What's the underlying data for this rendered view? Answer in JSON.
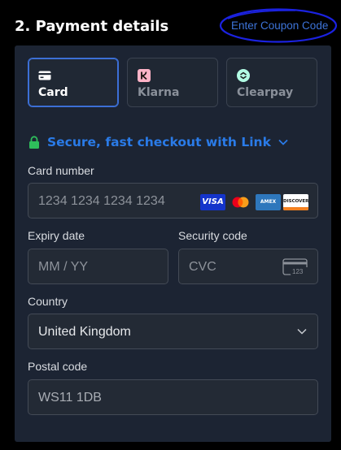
{
  "header": {
    "title": "2. Payment details",
    "coupon_link": "Enter Coupon Code"
  },
  "tabs": [
    {
      "label": "Card",
      "icon": "card-icon",
      "selected": true
    },
    {
      "label": "Klarna",
      "icon": "klarna-icon",
      "selected": false
    },
    {
      "label": "Clearpay",
      "icon": "clearpay-icon",
      "selected": false
    }
  ],
  "link": {
    "text": "Secure, fast checkout with Link"
  },
  "card_number": {
    "label": "Card number",
    "placeholder": "1234 1234 1234 1234",
    "brands": [
      {
        "name": "visa-logo",
        "text": "VISA"
      },
      {
        "name": "mastercard-logo"
      },
      {
        "name": "amex-logo",
        "text": "AMEX"
      },
      {
        "name": "discover-logo",
        "text": "DISCOVER"
      }
    ]
  },
  "expiry": {
    "label": "Expiry date",
    "placeholder": "MM / YY"
  },
  "security": {
    "label": "Security code",
    "placeholder": "CVC",
    "cvc_icon_text": "123"
  },
  "country": {
    "label": "Country",
    "value": "United Kingdom"
  },
  "postal": {
    "label": "Postal code",
    "value": "WS11 1DB"
  },
  "colors": {
    "background": "#000000",
    "panel": "#1c2433",
    "accent_blue": "#2a7be8",
    "selected_border": "#3c6fd6",
    "lock_green": "#2ebd5b"
  }
}
